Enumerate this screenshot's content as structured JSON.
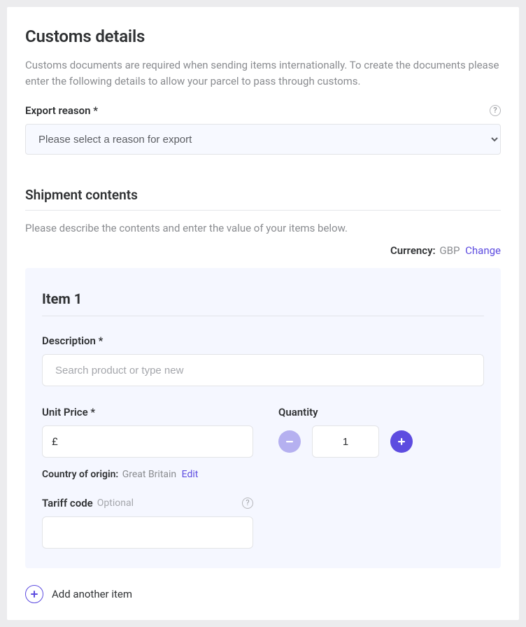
{
  "sectionTitle": "Customs details",
  "sectionSubtitle": "Customs documents are required when sending items internationally. To create the documents please enter the following details to allow your parcel to pass through customs.",
  "exportReason": {
    "label": "Export reason *",
    "placeholder": "Please select a reason for export"
  },
  "shipmentContents": {
    "heading": "Shipment contents",
    "description": "Please describe the contents and enter the value of your items below.",
    "currencyLabel": "Currency:",
    "currencyValue": "GBP",
    "changeLink": "Change"
  },
  "item": {
    "title": "Item 1",
    "descriptionLabel": "Description *",
    "descriptionPlaceholder": "Search product or type new",
    "unitPriceLabel": "Unit Price *",
    "unitPriceSymbol": "£",
    "unitPriceValue": "",
    "quantityLabel": "Quantity",
    "quantityValue": "1",
    "originLabel": "Country of origin:",
    "originValue": "Great Britain",
    "editLink": "Edit",
    "tariffLabel": "Tariff code",
    "tariffOptional": "Optional",
    "tariffValue": ""
  },
  "addAnother": "Add another item"
}
